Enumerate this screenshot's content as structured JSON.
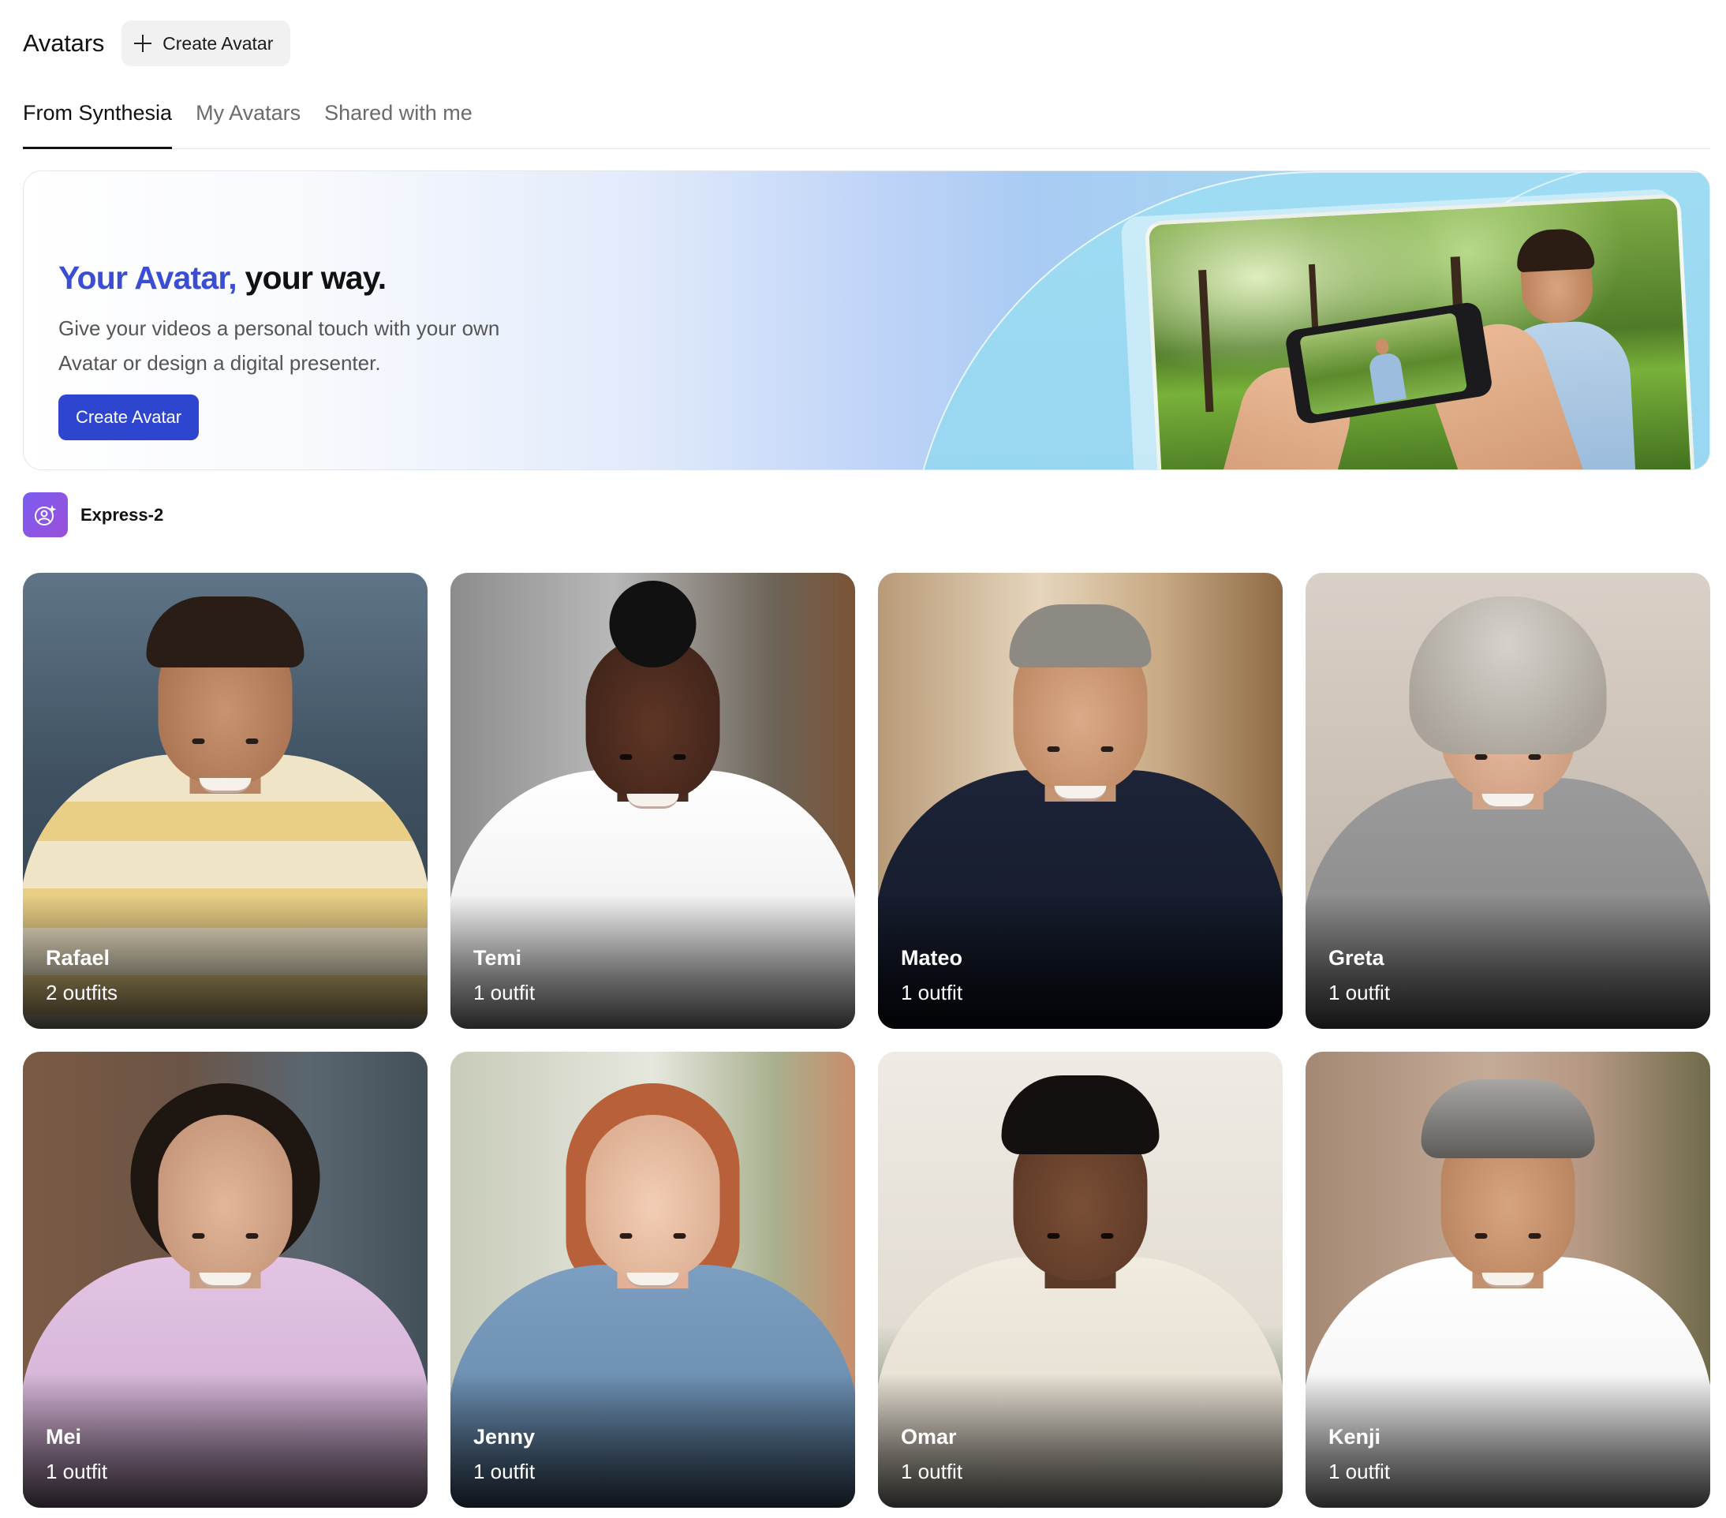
{
  "header": {
    "title": "Avatars",
    "create_label": "Create Avatar"
  },
  "tabs": [
    {
      "label": "From Synthesia",
      "active": true
    },
    {
      "label": "My Avatars",
      "active": false
    },
    {
      "label": "Shared with me",
      "active": false
    }
  ],
  "banner": {
    "heading_accent": "Your Avatar,",
    "heading_rest": " your way.",
    "subtitle": "Give your videos a personal touch with your own Avatar or design a digital presenter.",
    "button_label": "Create Avatar",
    "accent_color": "#3b4dd3",
    "button_color": "#2e45cf"
  },
  "section": {
    "label": "Express-2",
    "icon": "user-sparkle-icon",
    "icon_color": "#8a55e6"
  },
  "avatars": [
    {
      "name": "Rafael",
      "outfits": "2 outfits"
    },
    {
      "name": "Temi",
      "outfits": "1 outfit"
    },
    {
      "name": "Mateo",
      "outfits": "1 outfit"
    },
    {
      "name": "Greta",
      "outfits": "1 outfit"
    },
    {
      "name": "Mei",
      "outfits": "1 outfit"
    },
    {
      "name": "Jenny",
      "outfits": "1 outfit"
    },
    {
      "name": "Omar",
      "outfits": "1 outfit"
    },
    {
      "name": "Kenji",
      "outfits": "1 outfit"
    }
  ]
}
